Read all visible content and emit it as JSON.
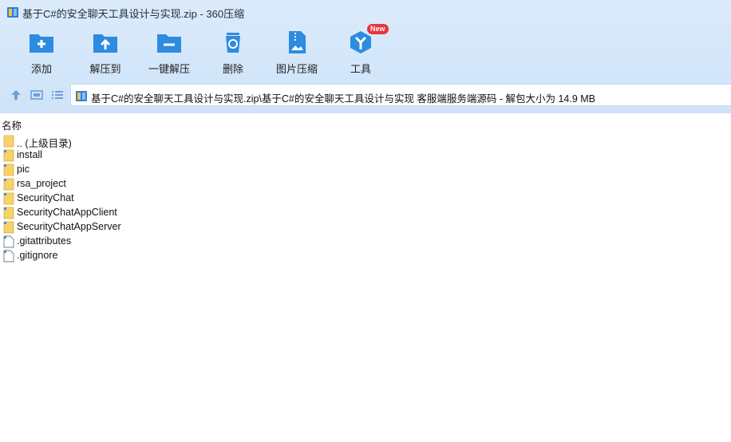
{
  "window": {
    "title": "基于C#的安全聊天工具设计与实现.zip - 360压缩"
  },
  "toolbar": {
    "items": [
      {
        "label": "添加",
        "icon": "add-icon"
      },
      {
        "label": "解压到",
        "icon": "extract-to-icon"
      },
      {
        "label": "一键解压",
        "icon": "one-click-extract-icon"
      },
      {
        "label": "删除",
        "icon": "delete-icon"
      },
      {
        "label": "图片压缩",
        "icon": "image-compress-icon"
      },
      {
        "label": "工具",
        "icon": "tools-icon",
        "badge": "New"
      }
    ]
  },
  "address": {
    "path": "基于C#的安全聊天工具设计与实现.zip\\基于C#的安全聊天工具设计与实现 客服端服务端源码 - 解包大小为 14.9 MB"
  },
  "list": {
    "column_name": "名称",
    "files": [
      {
        "name": ".. (上级目录)",
        "type": "folder"
      },
      {
        "name": "install",
        "type": "folder"
      },
      {
        "name": "pic",
        "type": "folder"
      },
      {
        "name": "rsa_project",
        "type": "folder"
      },
      {
        "name": "SecurityChat",
        "type": "folder"
      },
      {
        "name": "SecurityChatAppClient",
        "type": "folder"
      },
      {
        "name": "SecurityChatAppServer",
        "type": "folder"
      },
      {
        "name": ".gitattributes",
        "type": "file"
      },
      {
        "name": ".gitignore",
        "type": "file"
      }
    ]
  },
  "colors": {
    "toolbar_bg": "#d3e6fa",
    "icon_blue": "#2d8be0",
    "badge_red": "#e8343b",
    "folder_yellow": "#f7d26a"
  }
}
